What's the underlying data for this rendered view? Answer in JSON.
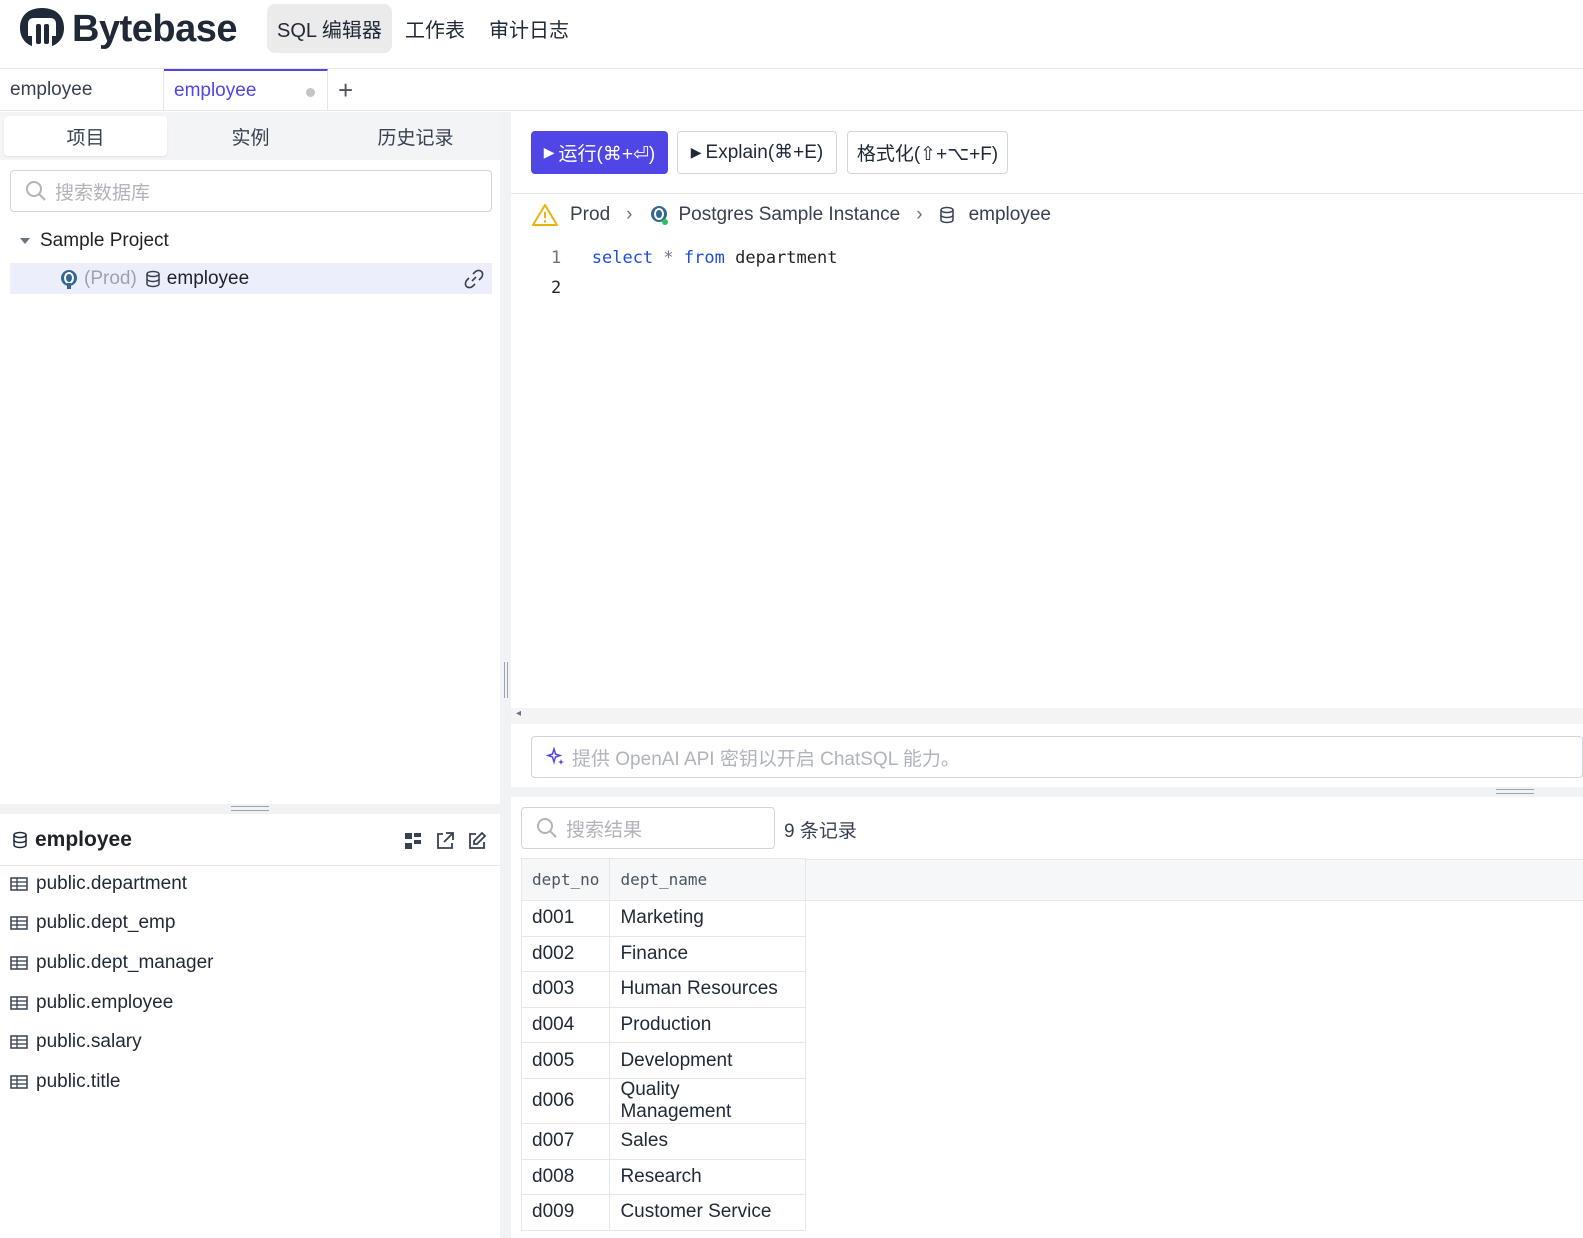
{
  "nav": {
    "logo_text": "Bytebase",
    "tabs": [
      "SQL 编辑器",
      "工作表",
      "审计日志"
    ]
  },
  "editor_tabs": [
    {
      "label": "employee"
    },
    {
      "label": "employee"
    }
  ],
  "left": {
    "tabs": [
      "项目",
      "实例",
      "历史记录"
    ],
    "search_placeholder": "搜索数据库",
    "project": "Sample Project",
    "db_env": "(Prod)",
    "db_name": "employee"
  },
  "schema": {
    "title": "employee",
    "tables": [
      "public.department",
      "public.dept_emp",
      "public.dept_manager",
      "public.employee",
      "public.salary",
      "public.title"
    ]
  },
  "toolbar": {
    "run": "运行(⌘+⏎)",
    "explain": "Explain(⌘+E)",
    "format": "格式化(⇧+⌥+F)"
  },
  "breadcrumb": {
    "env": "Prod",
    "instance": "Postgres Sample Instance",
    "database": "employee"
  },
  "code": {
    "line1_no": "1",
    "line2_no": "2",
    "kw_select": "select",
    "star": "*",
    "kw_from": "from",
    "table": "department"
  },
  "chatsql_placeholder": "提供 OpenAI API 密钥以开启 ChatSQL 能力。",
  "results": {
    "search_placeholder": "搜索结果",
    "count": "9 条记录",
    "columns": [
      "dept_no",
      "dept_name"
    ],
    "rows": [
      [
        "d001",
        "Marketing"
      ],
      [
        "d002",
        "Finance"
      ],
      [
        "d003",
        "Human Resources"
      ],
      [
        "d004",
        "Production"
      ],
      [
        "d005",
        "Development"
      ],
      [
        "d006",
        "Quality Management"
      ],
      [
        "d007",
        "Sales"
      ],
      [
        "d008",
        "Research"
      ],
      [
        "d009",
        "Customer Service"
      ]
    ]
  },
  "colors": {
    "accent": "#4f46e5",
    "warning": "#eab308"
  }
}
